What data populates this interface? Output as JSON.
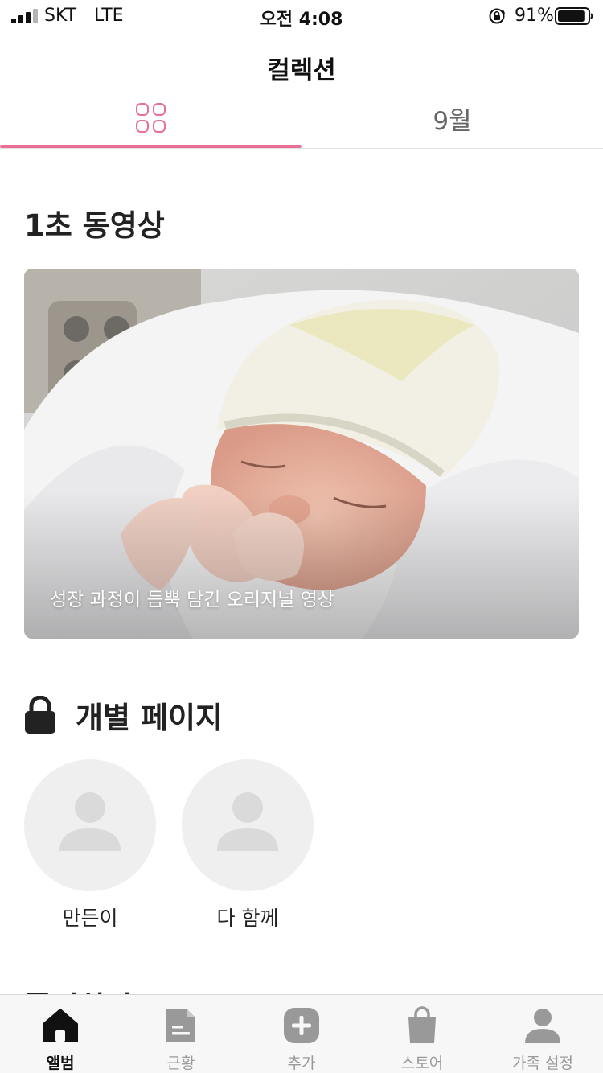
{
  "status_bar": {
    "carrier": "SKT",
    "network": "LTE",
    "time": "오전 4:08",
    "battery_percent": "91%",
    "battery_level": 0.91
  },
  "header": {
    "title": "컬렉션"
  },
  "tabs": {
    "active_index": 0,
    "items": [
      {
        "icon": "grid-icon",
        "label": ""
      },
      {
        "label": "9월"
      }
    ]
  },
  "video_section": {
    "title": "1초 동영상",
    "card": {
      "image": "newborn-baby-photo",
      "caption": "성장 과정이 듬뿍 담긴 오리지널 영상"
    }
  },
  "private_section": {
    "icon": "lock-icon",
    "title": "개별 페이지",
    "profiles": [
      {
        "name": "만든이",
        "icon": "person-icon"
      },
      {
        "name": "다 함께",
        "icon": "person-icon"
      }
    ]
  },
  "next_section": {
    "title": "플리하마"
  },
  "bottom_nav": {
    "active_index": 0,
    "items": [
      {
        "label": "앨범",
        "icon": "home-icon"
      },
      {
        "label": "근황",
        "icon": "document-icon"
      },
      {
        "label": "추가",
        "icon": "plus-icon"
      },
      {
        "label": "스토어",
        "icon": "shopping-bag-icon"
      },
      {
        "label": "가족 설정",
        "icon": "person-icon"
      }
    ]
  },
  "colors": {
    "accent": "#ea6f95",
    "text_primary": "#222222",
    "nav_inactive": "#9a9a9a",
    "avatar_bg": "#efefef"
  }
}
